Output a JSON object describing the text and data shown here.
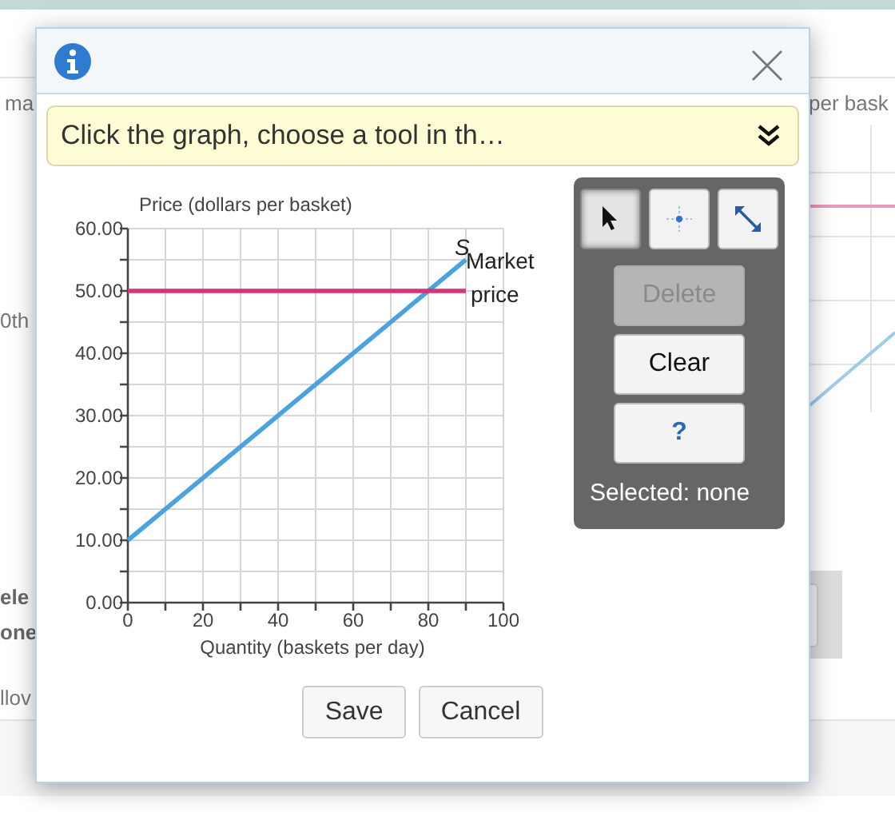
{
  "background_page": {
    "texts": [
      {
        "kind": "plain",
        "text": "ma"
      },
      {
        "kind": "plain",
        "text": "per bask"
      },
      {
        "kind": "plain",
        "text": "0th"
      },
      {
        "kind": "bold",
        "text": "ele"
      },
      {
        "kind": "bold",
        "text": "one"
      },
      {
        "kind": "plain",
        "text": "llov"
      }
    ]
  },
  "dialog": {
    "banner": {
      "text": "Click the graph, choose a tool in th…",
      "expanded": false
    },
    "graph": {
      "chart_data": {
        "type": "line",
        "grid": true,
        "ylabel": "Price (dollars per basket)",
        "xlabel": "Quantity (baskets per day)",
        "xlim": [
          0,
          100
        ],
        "ylim": [
          0,
          60
        ],
        "xticks": [
          0,
          20,
          40,
          60,
          80,
          100
        ],
        "yticks": [
          {
            "value": 0,
            "label": "0.00"
          },
          {
            "value": 10,
            "label": "10.00"
          },
          {
            "value": 20,
            "label": "20.00"
          },
          {
            "value": 30,
            "label": "30.00"
          },
          {
            "value": 40,
            "label": "40.00"
          },
          {
            "value": 50,
            "label": "50.00"
          },
          {
            "value": 60,
            "label": "60.00"
          }
        ],
        "x": [
          0,
          90
        ],
        "series": [
          {
            "name": "S",
            "color": "#4aa3df",
            "values": [
              10,
              55
            ]
          },
          {
            "name": "Market price",
            "color": "#d6337a",
            "values": [
              50,
              50
            ]
          }
        ]
      }
    },
    "toolbox": {
      "tools": [
        {
          "kind": "pointer",
          "selected": true
        },
        {
          "kind": "point",
          "selected": false
        },
        {
          "kind": "line",
          "selected": false
        }
      ],
      "buttons": [
        {
          "kind": "text",
          "label": "Delete",
          "disabled": true
        },
        {
          "kind": "text",
          "label": "Clear",
          "disabled": false
        },
        {
          "kind": "help",
          "label": "?",
          "disabled": false
        }
      ],
      "status": "Selected: none"
    },
    "footer_buttons": [
      "Save",
      "Cancel"
    ]
  }
}
